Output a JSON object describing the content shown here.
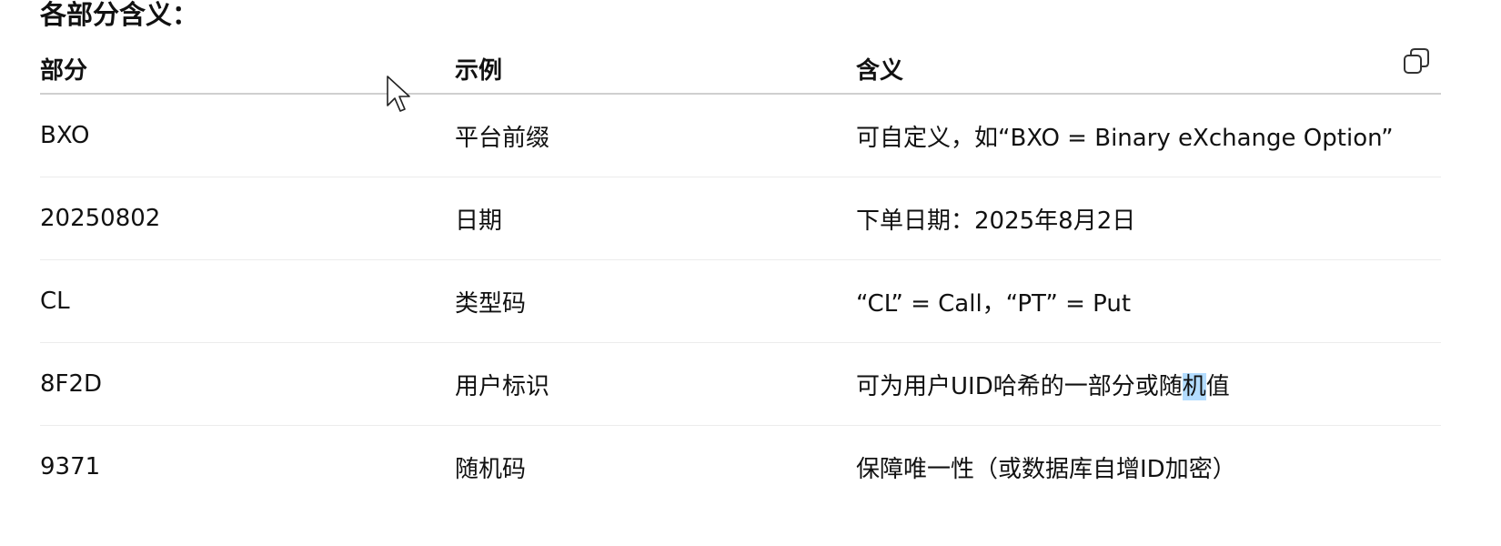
{
  "section_heading": "各部分含义：",
  "table": {
    "headers": [
      "部分",
      "示例",
      "含义"
    ],
    "rows": [
      {
        "part": "BXO",
        "example": "平台前缀",
        "meaning": "可自定义，如“BXO = Binary eXchange Option”"
      },
      {
        "part": "20250802",
        "example": "日期",
        "meaning": "下单日期：2025年8月2日"
      },
      {
        "part": "CL",
        "example": "类型码",
        "meaning": "“CL” = Call，“PT” = Put"
      },
      {
        "part": "8F2D",
        "example": "用户标识",
        "meaning_before": "可为用户UID哈希的一部分或随",
        "meaning_selected": "机",
        "meaning_after": "值"
      },
      {
        "part": "9371",
        "example": "随机码",
        "meaning": "保障唯一性（或数据库自增ID加密）"
      }
    ]
  },
  "icons": {
    "copy": "copy-icon",
    "cursor": "mouse-pointer-icon"
  },
  "colors": {
    "text": "#111111",
    "header_rule": "#cfcfcf",
    "row_rule": "#ececec",
    "selection": "#b3dcff"
  }
}
